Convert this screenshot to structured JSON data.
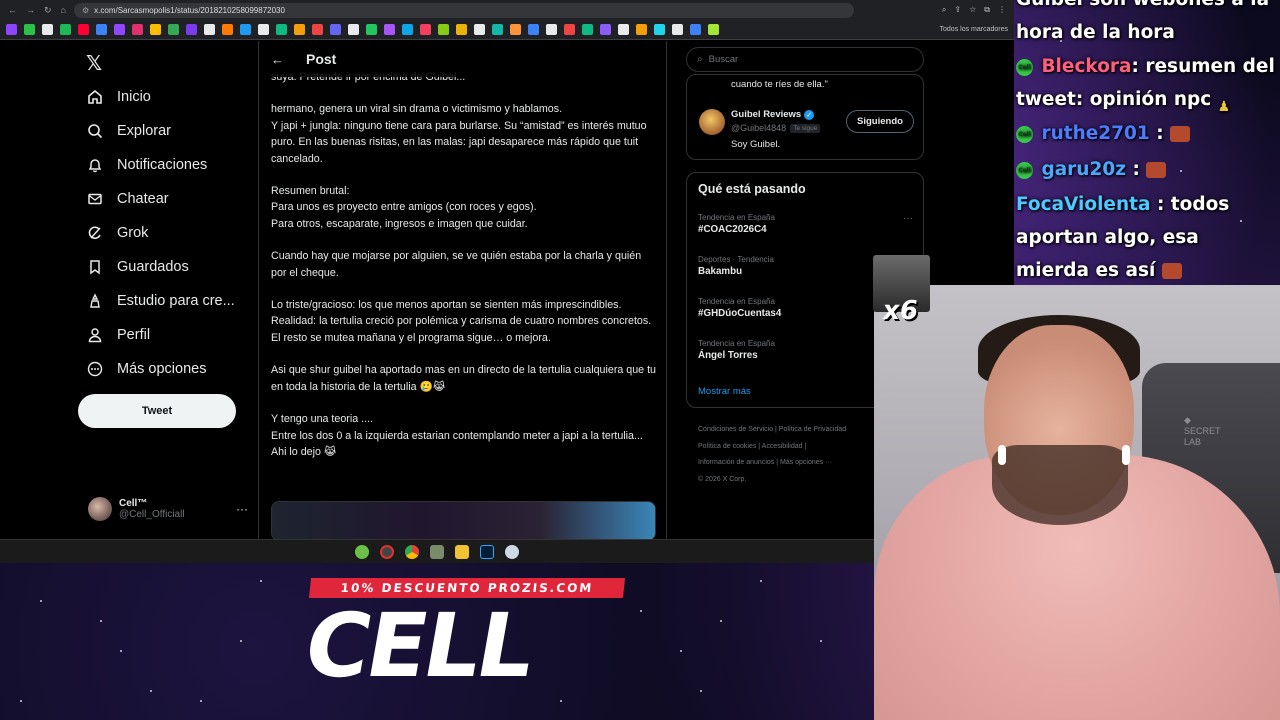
{
  "browser": {
    "url": "x.com/Sarcasmopolis1/status/2018210258099872030",
    "bookmarks_more": "Todos los marcadores"
  },
  "nav": {
    "items": [
      {
        "label": "Inicio",
        "icon": "home-icon"
      },
      {
        "label": "Explorar",
        "icon": "search-icon"
      },
      {
        "label": "Notificaciones",
        "icon": "bell-icon"
      },
      {
        "label": "Chatear",
        "icon": "mail-icon"
      },
      {
        "label": "Grok",
        "icon": "grok-icon"
      },
      {
        "label": "Guardados",
        "icon": "bookmark-icon"
      },
      {
        "label": "Estudio para cre...",
        "icon": "studio-icon"
      },
      {
        "label": "Perfil",
        "icon": "person-icon"
      },
      {
        "label": "Más opciones",
        "icon": "more-circle-icon"
      }
    ],
    "tweet_button": "Tweet",
    "profile": {
      "name": "Cell™",
      "handle": "@Cell_Officiall"
    }
  },
  "post": {
    "header": "Post",
    "paragraphs": [
      "suya. Pretende ir por encima de Guibel...",
      "hermano, genera un viral sin drama o victimismo y hablamos.\nY japi + jungla: ninguno tiene cara para burlarse. Su “amistad” es interés mutuo puro. En las buenas risitas, en las malas: japi desaparece más rápido que tuit cancelado.",
      "Resumen brutal:\nPara unos es proyecto entre amigos (con roces y egos).\nPara otros, escaparate, ingresos e imagen que cuidar.",
      "Cuando hay que mojarse por alguien, se ve quién estaba por la charla y quién por el cheque.",
      "Lo triste/gracioso: los que menos aportan se sienten más imprescindibles. Realidad: la tertulia creció por polémica y carisma de cuatro nombres concretos. El resto se mutea mañana y el programa sigue… o mejora.",
      "Asi que shur guibel ha aportado mas  en un directo de la tertulia cualquiera que tu en toda  la historia de la tertulia 🥲😹",
      "Y tengo una teoria ....\nEntre los dos 0 a la izquierda estarian contemplando meter a japi a la tertulia...\nAhi lo dejo 😹"
    ]
  },
  "sidebar": {
    "search_placeholder": "Buscar",
    "quote_tail": "cuando te ríes de ella.\"",
    "reviewer": {
      "name": "Guibel Reviews",
      "handle": "@Guibel4848",
      "follows_you": "Te sigue",
      "bio": "Soy Guibel.",
      "button": "Siguiendo"
    },
    "trends_title": "Qué está pasando",
    "trends": [
      {
        "meta": "Tendencia en España",
        "name": "#COAC2026C4"
      },
      {
        "meta": "Deportes · Tendencia",
        "name": "Bakambu"
      },
      {
        "meta": "Tendencia en España",
        "name": "#GHDúoCuentas4"
      },
      {
        "meta": "Tendencia en España",
        "name": "Ángel Torres"
      }
    ],
    "show_more": "Mostrar más",
    "footer": [
      "Condiciones de Servicio  |  Política de Privacidad",
      "Política de cookies  |  Accesibilidad  |",
      "Información de anuncios  |  Más opciones ···",
      "© 2026 X Corp."
    ]
  },
  "promo": {
    "banner": "10% DESCUENTO PROZIS.COM",
    "big": "CELL"
  },
  "chat": {
    "top": "Guibel son webones a la hora de la hora",
    "messages": [
      {
        "user": "Bleckora",
        "color": "#ff5f7e",
        "text": ": resumen del tweet: opinión npc"
      },
      {
        "user": "ruthe2701",
        "color": "#4d7cff",
        "text": ":"
      },
      {
        "user": "garu20z",
        "color": "#4aa8ff",
        "text": ":"
      },
      {
        "user": "FocaViolenta",
        "color": "#4ec9ff",
        "text": ": todos aportan algo, esa mierda es así"
      }
    ]
  },
  "overlay": {
    "combo": "x6"
  }
}
